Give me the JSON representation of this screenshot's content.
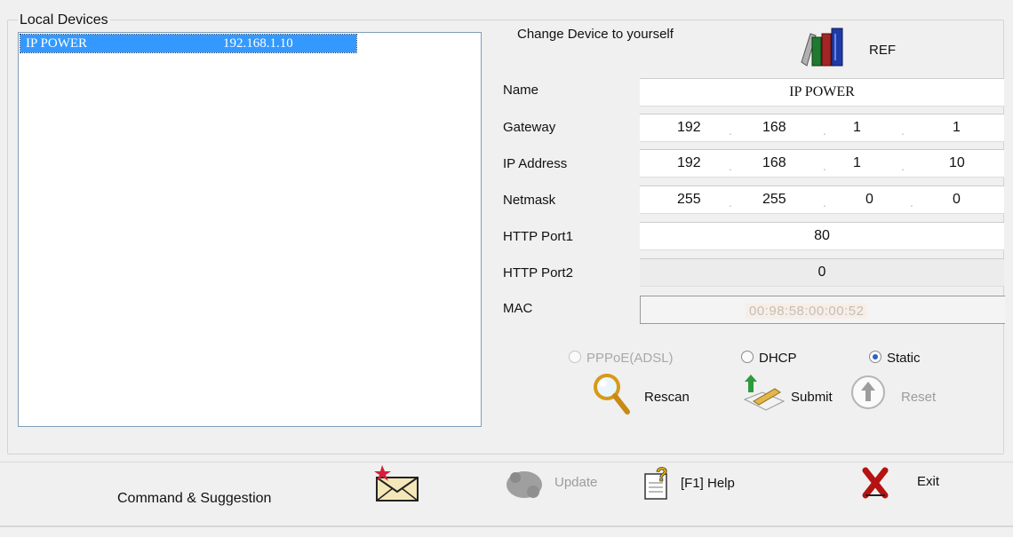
{
  "local_devices": {
    "title": "Local Devices",
    "items": [
      {
        "name": "IP POWER",
        "ip": "192.168.1.10"
      }
    ]
  },
  "config": {
    "title": "Change Device to yourself",
    "ref_label": "REF",
    "labels": {
      "name": "Name",
      "gateway": "Gateway",
      "ip": "IP Address",
      "netmask": "Netmask",
      "http1": "HTTP Port1",
      "http2": "HTTP Port2",
      "mac": "MAC"
    },
    "name_value": "IP POWER",
    "gateway": [
      "192",
      "168",
      "1",
      "1"
    ],
    "ip": [
      "192",
      "168",
      "1",
      "10"
    ],
    "netmask": [
      "255",
      "255",
      "0",
      "0"
    ],
    "octet_dot": ".",
    "http_port1": "80",
    "http_port2": "0",
    "mac": "00:98:58:00:00:52",
    "mode_options": [
      {
        "label": "PPPoE(ADSL)",
        "selected": false,
        "enabled": false
      },
      {
        "label": "DHCP",
        "selected": false,
        "enabled": true
      },
      {
        "label": "Static",
        "selected": true,
        "enabled": true
      }
    ],
    "rescan_label": "Rescan",
    "submit_label": "Submit",
    "reset_label": "Reset"
  },
  "bottom": {
    "command_label": "Command & Suggestion",
    "update_label": "Update",
    "help_label": "[F1] Help",
    "exit_label": "Exit"
  },
  "colors": {
    "selection": "#3399ff",
    "window_bg": "#f0f0f0"
  }
}
